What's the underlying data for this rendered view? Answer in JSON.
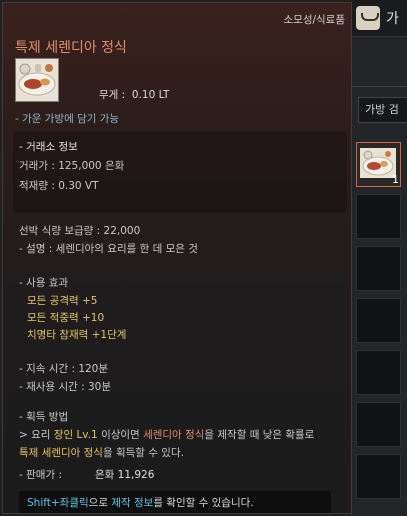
{
  "tooltip": {
    "category": "소모성/식료품",
    "item_name": "특제 세렌디아 정식",
    "weight_label": "무게 :",
    "weight_value": "0.10 LT",
    "bag_note": "- 가운 가방에 담기 가능",
    "market": {
      "title": "- 거래소 정보",
      "price": "거래가 : 125,000 은화",
      "stock": "적재량 : 0.30 VT"
    },
    "ship_supply": "선박 식량 보급량 : 22,000",
    "description": "- 설명 : 세렌디아의 요리를 한 데 모은 것",
    "effects_header": "- 사용 효과",
    "effects": [
      "모든 공격력 +5",
      "모든 적중력 +10",
      "치명타 참재력 +1단계"
    ],
    "duration": "- 지속 시간 : 120분",
    "cooldown": "- 재사용 시간 : 30분",
    "acquisition_header": "- 획득 방법",
    "acquisition": {
      "p1": "> 요리 ",
      "p2": "장인 Lv.1",
      "p3": " 이상이면 ",
      "p4": "세렌디아 정식",
      "p5": "을 제작할 때 낮은 확률로",
      "p6": "특제 세렌디아 정식",
      "p7": "을 획득할 수 있다."
    },
    "sell_label": "- 판매가 :",
    "sell_value": "은화 11,926",
    "hint": {
      "keys": "Shift+좌클릭",
      "mid": "으로 ",
      "info": "제작 정보",
      "end": "를 확인할 수 있습니다."
    }
  },
  "inventory": {
    "title": "가",
    "search_label": "가방 검",
    "item_quantity": "1"
  },
  "colors": {
    "item_name": "#e48c6d",
    "effect": "#e6c85a",
    "hint_key": "#5fc3e8"
  }
}
